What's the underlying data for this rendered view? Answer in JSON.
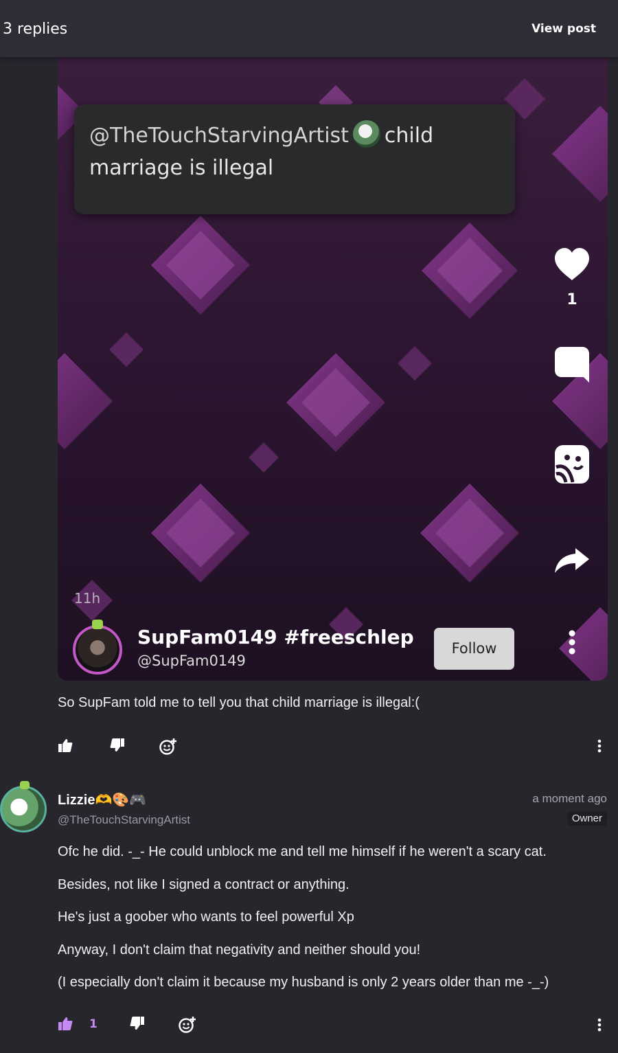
{
  "header": {
    "replies_label": "3 replies",
    "view_post_label": "View post"
  },
  "post": {
    "bubble": {
      "mention": "@TheTouchStarvingArtist",
      "text_after": "child",
      "text_line2": "marriage is illegal"
    },
    "likes_count": "1",
    "timestamp": "11h",
    "creator": {
      "name": "SupFam0149 #freeschlep",
      "handle": "@SupFam0149",
      "follow_label": "Follow"
    },
    "caption": "So SupFam told me to tell you that child marriage is illegal:("
  },
  "reply": {
    "author_name": "Lizzie🫶🎨🎮",
    "author_handle": "@TheTouchStarvingArtist",
    "time": "a moment ago",
    "badge": "Owner",
    "lines": [
      "Ofc he did. -_- He could unblock me and tell me himself if he weren't a scary cat.",
      "Besides, not like I signed a contract or anything.",
      "He's just a goober who wants to feel powerful Xp",
      "Anyway, I don't claim that negativity and neither should you!",
      "(I especially don't claim it because my husband is only 2 years older than me -_-)"
    ],
    "upvotes": "1"
  },
  "colors": {
    "background": "#27262d",
    "accent_purple": "#c58bf2",
    "media_purple": "#6d2f72"
  }
}
